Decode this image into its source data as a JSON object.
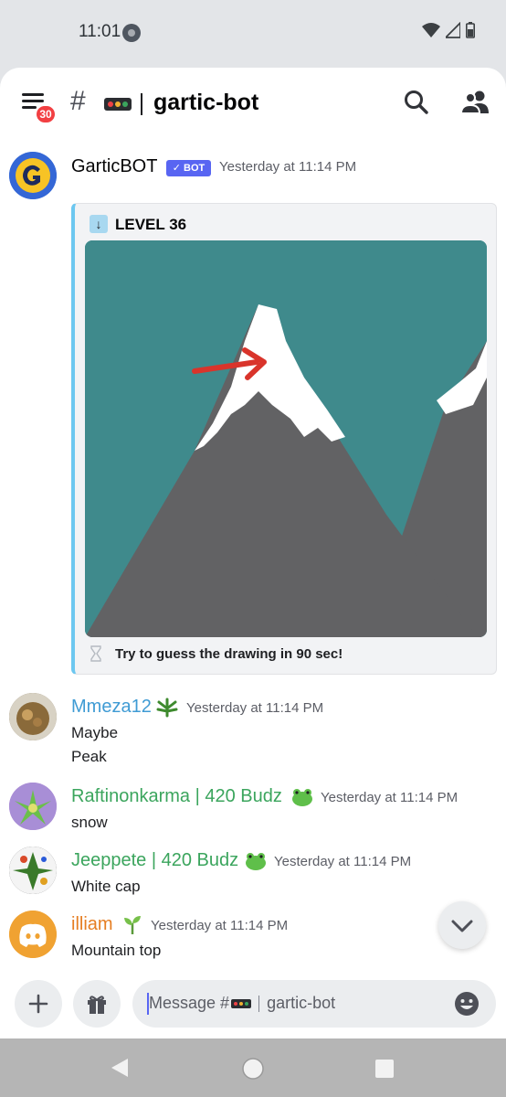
{
  "status_bar": {
    "time": "11:01"
  },
  "header": {
    "menu_badge": "30",
    "hash": "#",
    "channel_name": "gartic-bot"
  },
  "messages": [
    {
      "author": "GarticBOT",
      "author_color": "#060607",
      "bot_tag": "✓ BOT",
      "timestamp": "Yesterday at 11:14 PM",
      "avatar_icon": "gartic-logo",
      "embed": {
        "title": "LEVEL 36",
        "image": "drawing of a snow-capped mountain with a red arrow pointing at the peak",
        "footer": "Try to guess the drawing in 90 sec!"
      }
    },
    {
      "author": "Mmeza12",
      "author_color": "#3f9bd4",
      "badge_icon": "leaf-icon",
      "timestamp": "Yesterday at 11:14 PM",
      "lines": [
        "Maybe",
        "Peak"
      ]
    },
    {
      "author": "Raftinonkarma | 420 Budz",
      "author_color": "#3ba55d",
      "badge_icon": "frog-icon",
      "timestamp": "Yesterday at 11:14 PM",
      "lines": [
        "snow"
      ]
    },
    {
      "author": "Jeeppete | 420 Budz",
      "author_color": "#3ba55d",
      "badge_icon": "frog-icon",
      "timestamp": "Yesterday at 11:14 PM",
      "lines": [
        "White cap"
      ]
    },
    {
      "author": "illiam",
      "author_color": "#e67e22",
      "badge_icon": "sprout-icon",
      "timestamp": "Yesterday at 11:14 PM",
      "avatar_icon": "discord-logo",
      "lines": [
        "Mountain top"
      ]
    }
  ],
  "input": {
    "placeholder_prefix": "Message #",
    "placeholder_channel": "gartic-bot"
  },
  "colors": {
    "accent": "#5865f2",
    "embed_border": "#6cc7f0",
    "discord_orange": "#f0a232"
  }
}
